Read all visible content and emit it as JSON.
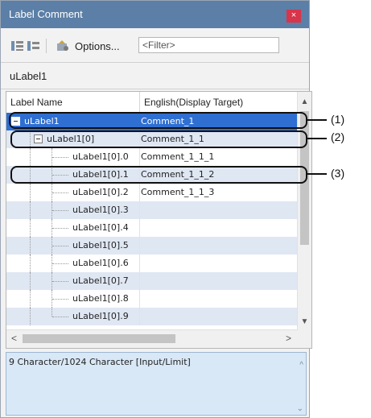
{
  "window": {
    "title": "Label Comment",
    "close_glyph": "×"
  },
  "toolbar": {
    "options_label": "Options...",
    "filter_placeholder": "<Filter>",
    "icons": [
      "expand-all-icon",
      "collapse-all-icon",
      "options-icon"
    ]
  },
  "current_label": "uLabel1",
  "grid": {
    "columns": [
      "Label Name",
      "English(Display Target)"
    ],
    "rows": [
      {
        "name": "uLabel1",
        "comment": "Comment_1",
        "level": 0,
        "expander": true,
        "selected": true
      },
      {
        "name": "uLabel1[0]",
        "comment": "Comment_1_1",
        "level": 1,
        "expander": true
      },
      {
        "name": "uLabel1[0].0",
        "comment": "Comment_1_1_1",
        "level": 2
      },
      {
        "name": "uLabel1[0].1",
        "comment": "Comment_1_1_2",
        "level": 2
      },
      {
        "name": "uLabel1[0].2",
        "comment": "Comment_1_1_3",
        "level": 2
      },
      {
        "name": "uLabel1[0].3",
        "comment": "",
        "level": 2
      },
      {
        "name": "uLabel1[0].4",
        "comment": "",
        "level": 2
      },
      {
        "name": "uLabel1[0].5",
        "comment": "",
        "level": 2
      },
      {
        "name": "uLabel1[0].6",
        "comment": "",
        "level": 2
      },
      {
        "name": "uLabel1[0].7",
        "comment": "",
        "level": 2
      },
      {
        "name": "uLabel1[0].8",
        "comment": "",
        "level": 2
      },
      {
        "name": "uLabel1[0].9",
        "comment": "",
        "level": 2
      }
    ]
  },
  "status": {
    "char_count_text": "9 Character/1024 Character [Input/Limit]"
  },
  "callouts": [
    "(1)",
    "(2)",
    "(3)"
  ],
  "colors": {
    "title_bar": "#5b7fa6",
    "selection": "#2f6fd1",
    "alt_row": "#dfe7f3",
    "close_button": "#d8344a"
  }
}
